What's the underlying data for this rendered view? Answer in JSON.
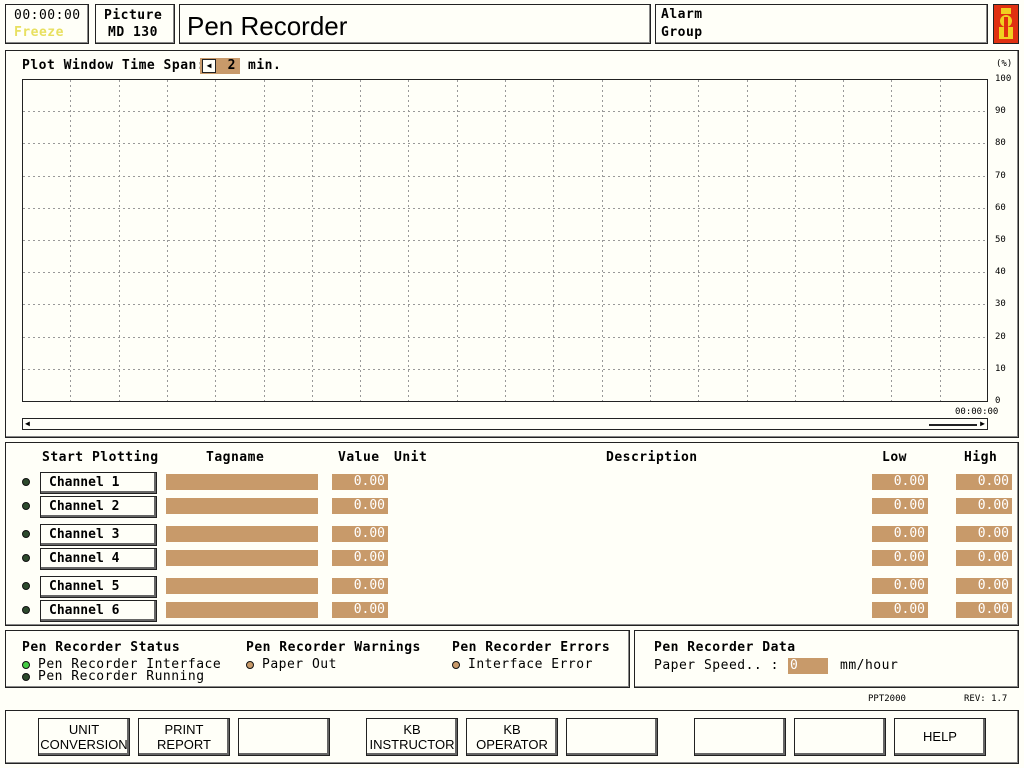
{
  "header": {
    "time": "00:00:00",
    "freeze_label": "Freeze",
    "picture_label": "Picture",
    "picture_id": "MD 130",
    "title": "Pen Recorder",
    "alarm_label": "Alarm",
    "group_label": "Group"
  },
  "plot": {
    "time_span_label": "Plot Window Time Span:",
    "time_span_value": "2",
    "time_span_unit": "min.",
    "y_unit": "(%)",
    "time_readout": "00:00:00",
    "y_ticks": [
      "100",
      "90",
      "80",
      "70",
      "60",
      "50",
      "40",
      "30",
      "20",
      "10",
      "0"
    ]
  },
  "chart_data": {
    "type": "line",
    "series": [],
    "ylabel": "(%)",
    "ylim": [
      0,
      100
    ],
    "yticks": [
      100,
      90,
      80,
      70,
      60,
      50,
      40,
      30,
      20,
      10,
      0
    ],
    "time_span_min": 2,
    "grid": true
  },
  "channels": {
    "headers": {
      "start": "Start Plotting",
      "tagname": "Tagname",
      "value": "Value",
      "unit": "Unit",
      "description": "Description",
      "low": "Low",
      "high": "High"
    },
    "rows": [
      {
        "label": "Channel  1",
        "value": "0.00",
        "low": "0.00",
        "high": "0.00"
      },
      {
        "label": "Channel  2",
        "value": "0.00",
        "low": "0.00",
        "high": "0.00"
      },
      {
        "label": "Channel  3",
        "value": "0.00",
        "low": "0.00",
        "high": "0.00"
      },
      {
        "label": "Channel  4",
        "value": "0.00",
        "low": "0.00",
        "high": "0.00"
      },
      {
        "label": "Channel  5",
        "value": "0.00",
        "low": "0.00",
        "high": "0.00"
      },
      {
        "label": "Channel  6",
        "value": "0.00",
        "low": "0.00",
        "high": "0.00"
      }
    ]
  },
  "status": {
    "title": "Pen Recorder Status",
    "items": [
      "Pen Recorder Interface",
      "Pen Recorder Running"
    ],
    "warnings_title": "Pen Recorder Warnings",
    "warnings": [
      "Paper Out"
    ],
    "errors_title": "Pen Recorder Errors",
    "errors": [
      "Interface Error"
    ]
  },
  "recorder_data": {
    "title": "Pen Recorder Data",
    "paper_speed_label": "Paper Speed.. :",
    "paper_speed_value": "0",
    "paper_speed_unit": "mm/hour"
  },
  "footer": {
    "ppt": "PPT2000",
    "rev": "REV: 1.7"
  },
  "buttons": {
    "unit_conversion_1": "UNIT",
    "unit_conversion_2": "CONVERSION",
    "print_report_1": "PRINT",
    "print_report_2": "REPORT",
    "kb_instructor_1": "KB",
    "kb_instructor_2": "INSTRUCTOR",
    "kb_operator_1": "KB",
    "kb_operator_2": "OPERATOR",
    "help": "HELP"
  },
  "colors": {
    "field": "#c89a6a",
    "background": "#fffff8",
    "led_on": "#44cc44",
    "freeze": "#e8e060"
  }
}
